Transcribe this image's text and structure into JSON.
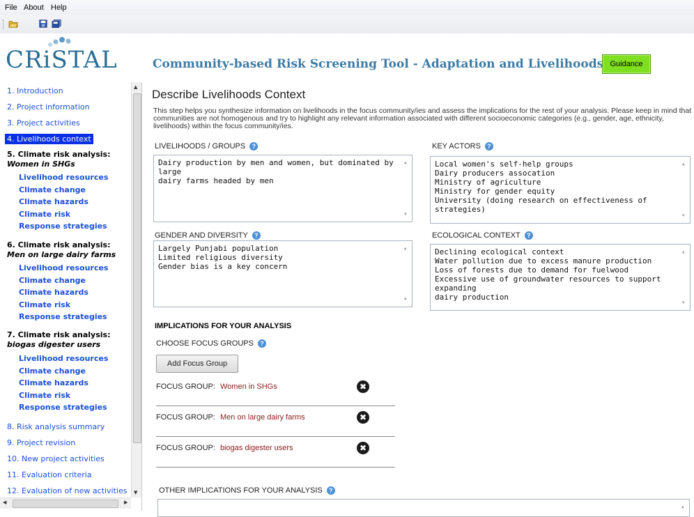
{
  "menu": {
    "file": "File",
    "about": "About",
    "help": "Help"
  },
  "toolbar": {
    "icons": [
      "open-folder-icon",
      "save-icon",
      "save-all-icon"
    ]
  },
  "logo": {
    "text": "CRiSTAL"
  },
  "app": {
    "title": "Community-based Risk Screening Tool - Adaptation and Livelihoods",
    "guidance_label": "Guidance"
  },
  "sidebar": {
    "items": [
      {
        "label": "1. Introduction"
      },
      {
        "label": "2. Project information"
      },
      {
        "label": "3. Project activities"
      },
      {
        "label": "4. Livelihoods context"
      },
      {
        "label": "8. Risk analysis summary"
      },
      {
        "label": "9. Project revision"
      },
      {
        "label": "10. New project activities"
      },
      {
        "label": "11. Evaluation criteria"
      },
      {
        "label": "12. Evaluation of new activities"
      }
    ],
    "groups": [
      {
        "head": "5. Climate risk analysis:",
        "sub": "Women in SHGs",
        "links": [
          "Livelihood resources",
          "Climate change",
          "Climate hazards",
          "Climate risk",
          "Response strategies"
        ]
      },
      {
        "head": "6. Climate risk analysis:",
        "sub": "Men on large dairy farms",
        "links": [
          "Livelihood resources",
          "Climate change",
          "Climate hazards",
          "Climate risk",
          "Response strategies"
        ]
      },
      {
        "head": "7. Climate risk analysis:",
        "sub": "biogas digester users",
        "links": [
          "Livelihood resources",
          "Climate change",
          "Climate hazards",
          "Climate risk",
          "Response strategies"
        ]
      }
    ],
    "active_index": 3
  },
  "main": {
    "title": "Describe Livelihoods Context",
    "description": "This step helps you synthesize information on livelihoods in the focus community/ies and assess the implications for the rest of your analysis. Please keep in mind that communities are not homogenous and try to highlight any relevant information associated with different socioeconomic categories (e.g., gender, age, ethnicity, livelihoods) within the focus community/ies.",
    "livelihoods": {
      "label": "LIVELIHOODS / GROUPS",
      "lines": [
        "Dairy production by men and women, but dominated by large",
        "dairy farms headed by men"
      ]
    },
    "key_actors": {
      "label": "KEY ACTORS",
      "lines": [
        "Local women's self-help groups",
        "Dairy producers assocation",
        "Ministry of agriculture",
        "Ministry for gender equity",
        "University (doing research on effectiveness of strategies)"
      ]
    },
    "gender": {
      "label": "GENDER AND DIVERSITY",
      "lines": [
        "Largely Punjabi population",
        "Limited religious diversity",
        "Gender bias is a key concern"
      ]
    },
    "ecological": {
      "label": "ECOLOGICAL CONTEXT",
      "lines": [
        "Declining ecological context",
        "Water pollution due to excess manure production",
        "Loss of forests due to demand for fuelwood",
        "Excessive use of groundwater resources to support expanding",
        "dairy production"
      ]
    },
    "implications_heading": "IMPLICATIONS FOR YOUR ANALYSIS",
    "choose_label": "CHOOSE FOCUS GROUPS",
    "add_button": "Add Focus Group",
    "focus_key": "FOCUS GROUP:",
    "focus_groups": [
      "Women in SHGs",
      "Men on large dairy farms",
      "biogas digester users"
    ],
    "remove_glyph": "✖",
    "other_label": "OTHER IMPLICATIONS FOR YOUR ANALYSIS"
  }
}
